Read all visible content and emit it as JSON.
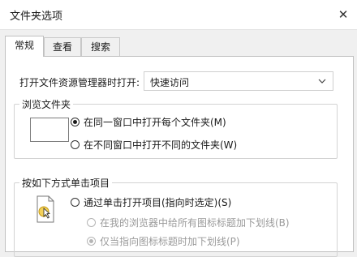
{
  "window": {
    "title": "文件夹选项",
    "close_glyph": "✕"
  },
  "tabs": [
    {
      "label": "常规",
      "active": true
    },
    {
      "label": "查看",
      "active": false
    },
    {
      "label": "搜索",
      "active": false
    }
  ],
  "open_explorer": {
    "label": "打开文件资源管理器时打开:",
    "selected": "快速访问"
  },
  "browse_folders": {
    "title": "浏览文件夹",
    "options": [
      {
        "label": "在同一窗口中打开每个文件夹(M)",
        "checked": true
      },
      {
        "label": "在不同窗口中打开不同的文件夹(W)",
        "checked": false
      }
    ]
  },
  "click_items": {
    "title": "按如下方式单击项目",
    "options": [
      {
        "label": "通过单击打开项目(指向时选定)(S)",
        "checked": false
      },
      {
        "label": "在我的浏览器中给所有图标标题加下划线(B)",
        "checked": false,
        "disabled": true
      },
      {
        "label": "仅当指向图标标题时加下划线(P)",
        "checked": true,
        "disabled": true
      }
    ]
  }
}
